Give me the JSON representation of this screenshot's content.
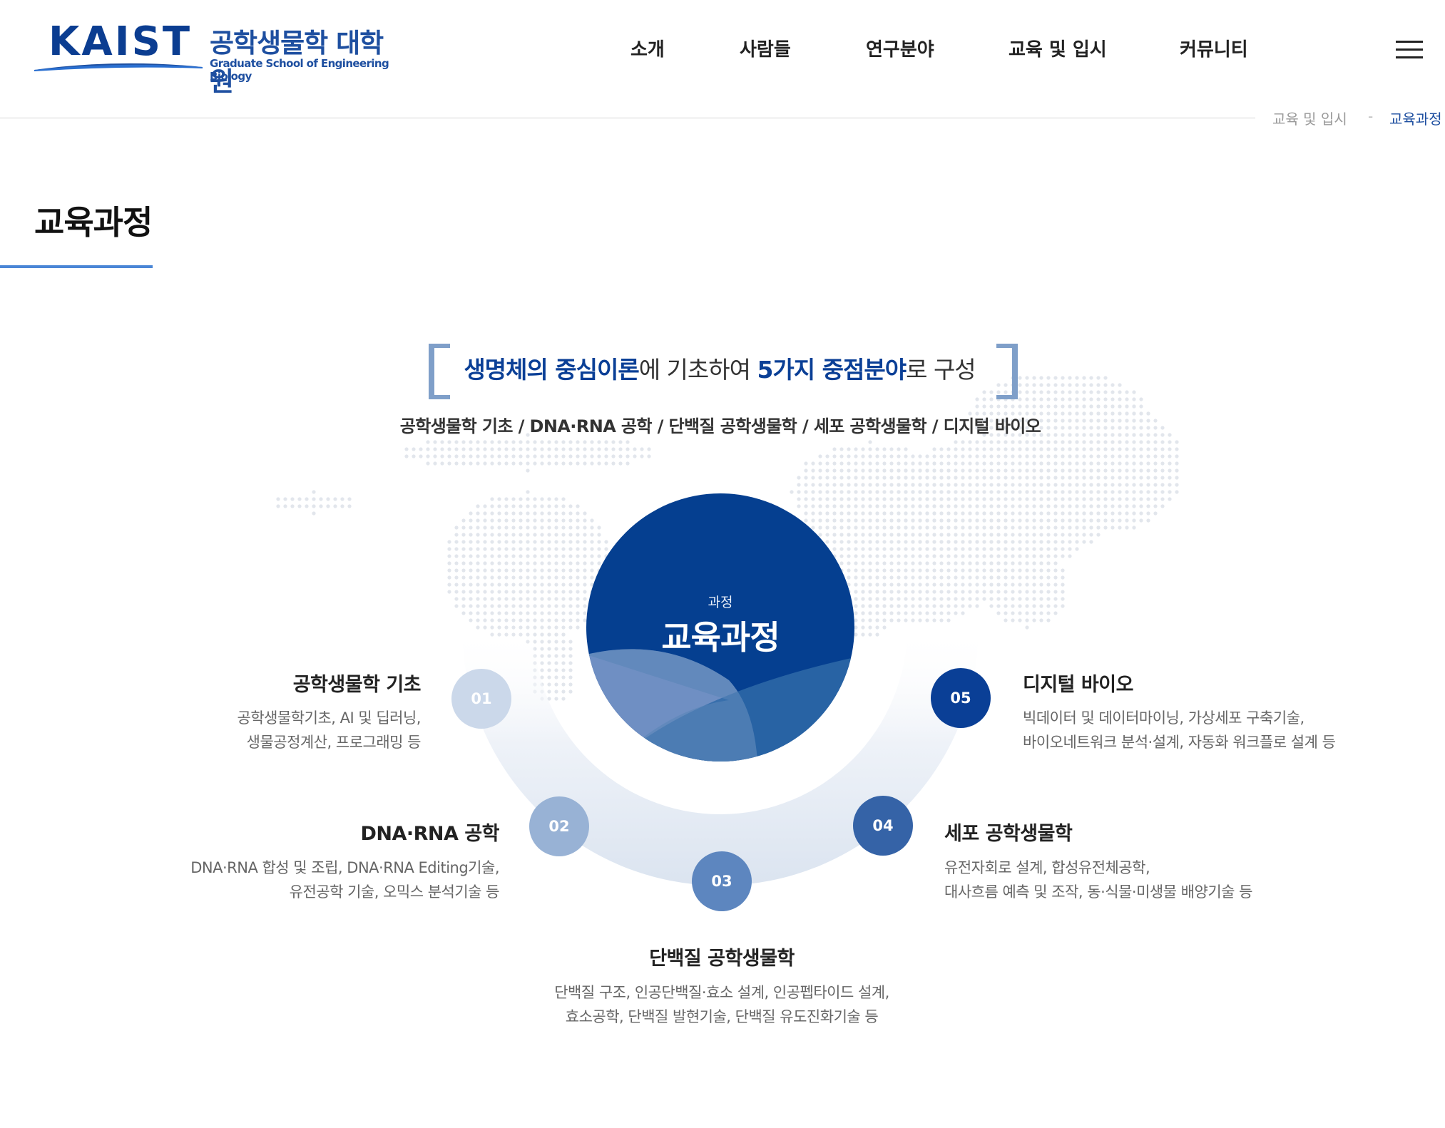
{
  "logo": {
    "kaist": "KAIST",
    "name_ko": "공학생물학 대학원",
    "name_en": "Graduate School of Engineering Biology"
  },
  "nav": {
    "items": [
      {
        "label": "소개"
      },
      {
        "label": "사람들"
      },
      {
        "label": "연구분야"
      },
      {
        "label": "교육 및 입시"
      },
      {
        "label": "커뮤니티"
      }
    ],
    "menu_icon": "hamburger-icon"
  },
  "breadcrumb": {
    "items": [
      "교육 및 입시",
      "교육과정"
    ],
    "separator": "-"
  },
  "page": {
    "title": "교육과정"
  },
  "intro": {
    "headline_part1": "생명체의 중심이론",
    "headline_part2": "에 기초하여 ",
    "headline_part3": "5가지 중점분야",
    "headline_part4": "로 구성",
    "subline": "공학생물학 기초 / DNA·RNA 공학 / 단백질 공학생물학 / 세포 공학생물학 / 디지털 바이오"
  },
  "center": {
    "small": "과정",
    "big": "교육과정"
  },
  "fields": [
    {
      "num": "01",
      "title": "공학생물학 기초",
      "desc1": "공학생물학기초, AI 및 딥러닝,",
      "desc2": "생물공정계산, 프로그래밍 등",
      "color": "#cbd8ea"
    },
    {
      "num": "02",
      "title": "DNA·RNA 공학",
      "desc1": "DNA·RNA 합성 및 조립, DNA·RNA Editing기술,",
      "desc2": "유전공학 기술, 오믹스 분석기술 등",
      "color": "#98b2d5"
    },
    {
      "num": "03",
      "title": "단백질 공학생물학",
      "desc1": "단백질 구조, 인공단백질·효소 설계, 인공펩타이드 설계,",
      "desc2": "효소공학, 단백질 발현기술, 단백질 유도진화기술 등",
      "color": "#5d86bf"
    },
    {
      "num": "04",
      "title": "세포 공학생물학",
      "desc1": "유전자회로 설계, 합성유전체공학,",
      "desc2": "대사흐름 예측 및 조작, 동·식물·미생물 배양기술 등",
      "color": "#3563a7"
    },
    {
      "num": "05",
      "title": "디지털 바이오",
      "desc1": "빅데이터 및 데이터마이닝, 가상세포 구축기술,",
      "desc2": "바이오네트워크 분석·설계, 자동화 워크플로 설계 등",
      "color": "#0a3f96"
    }
  ],
  "colors": {
    "brand": "#0a3f96",
    "accent_line": "#4a86d6"
  }
}
